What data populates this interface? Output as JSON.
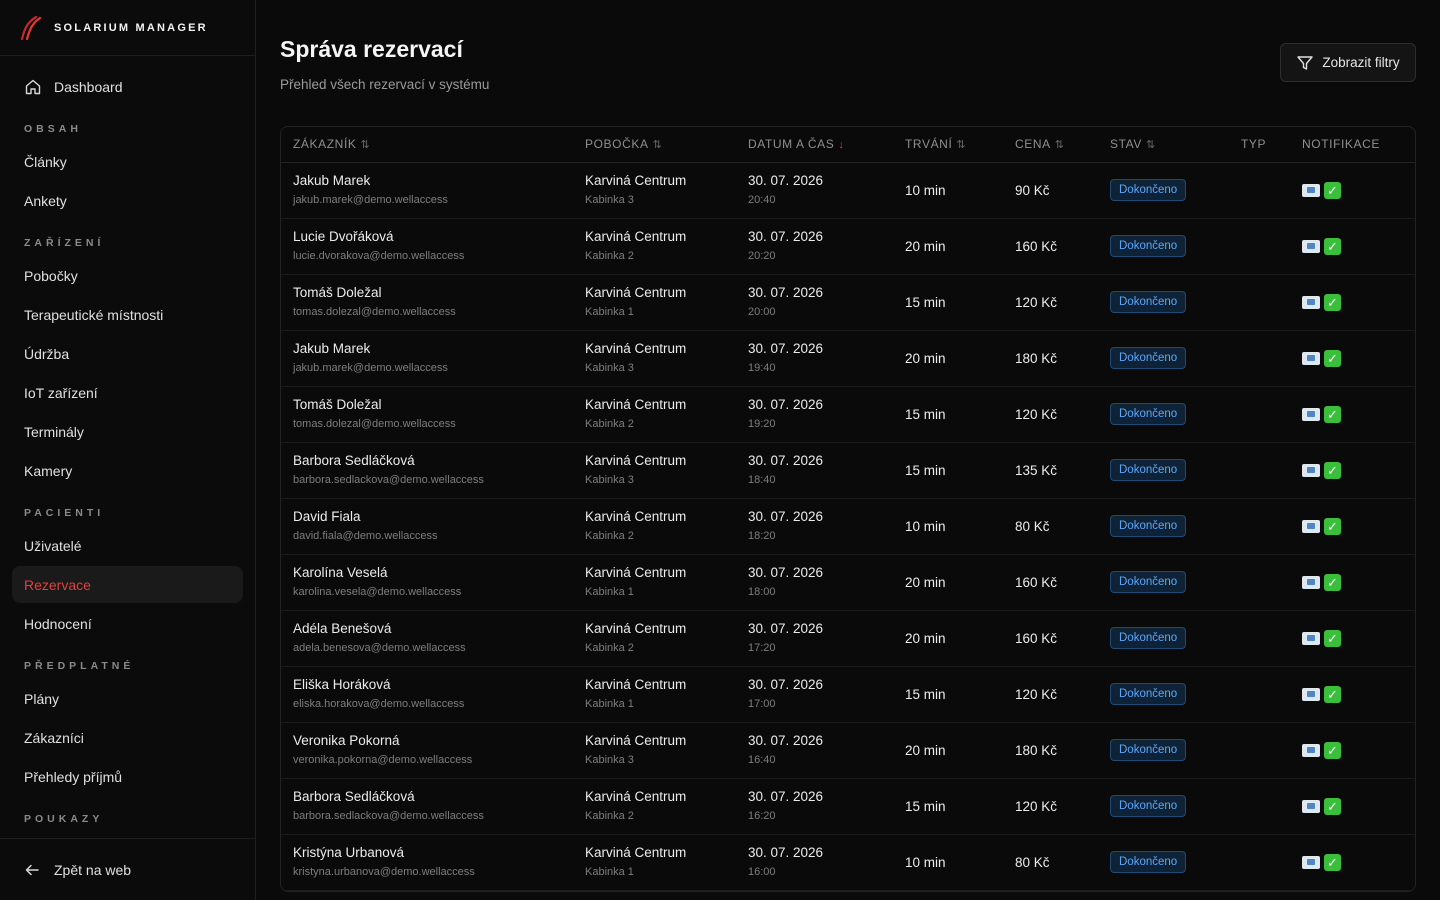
{
  "brand": {
    "name": "SOLARIUM MANAGER"
  },
  "sidebar": {
    "dashboard": "Dashboard",
    "sections": [
      {
        "title": "OBSAH",
        "items": [
          "Články",
          "Ankety"
        ]
      },
      {
        "title": "ZAŘÍZENÍ",
        "items": [
          "Pobočky",
          "Terapeutické místnosti",
          "Údržba",
          "IoT zařízení",
          "Terminály",
          "Kamery"
        ]
      },
      {
        "title": "PACIENTI",
        "items": [
          "Uživatelé",
          "Rezervace",
          "Hodnocení"
        ]
      },
      {
        "title": "PŘEDPLATNÉ",
        "items": [
          "Plány",
          "Zákazníci",
          "Přehledy příjmů"
        ]
      },
      {
        "title": "POUKAZY",
        "items": []
      }
    ],
    "active_item": "Rezervace",
    "footer": "Zpět na web"
  },
  "header": {
    "title": "Správa rezervací",
    "subtitle": "Přehled všech rezervací v systému",
    "filter_button": "Zobrazit filtry"
  },
  "colors": {
    "accent": "#e43f3f",
    "badge_text": "#58a8ff",
    "badge_bg": "#0f2236"
  },
  "table": {
    "columns": [
      {
        "label": "ZÁKAZNÍK",
        "sort": "both"
      },
      {
        "label": "POBOČKA",
        "sort": "both"
      },
      {
        "label": "DATUM A ČAS",
        "sort": "desc"
      },
      {
        "label": "TRVÁNÍ",
        "sort": "both"
      },
      {
        "label": "CENA",
        "sort": "both"
      },
      {
        "label": "STAV",
        "sort": "both"
      },
      {
        "label": "TYP",
        "sort": "none"
      },
      {
        "label": "NOTIFIKACE",
        "sort": "none"
      }
    ],
    "rows": [
      {
        "name": "Jakub Marek",
        "email": "jakub.marek@demo.wellaccess",
        "branch": "Karviná Centrum",
        "cabin": "Kabinka 3",
        "date": "30. 07. 2026",
        "time": "20:40",
        "duration": "10 min",
        "price": "90 Kč",
        "status": "Dokončeno"
      },
      {
        "name": "Lucie Dvořáková",
        "email": "lucie.dvorakova@demo.wellaccess",
        "branch": "Karviná Centrum",
        "cabin": "Kabinka 2",
        "date": "30. 07. 2026",
        "time": "20:20",
        "duration": "20 min",
        "price": "160 Kč",
        "status": "Dokončeno"
      },
      {
        "name": "Tomáš Doležal",
        "email": "tomas.dolezal@demo.wellaccess",
        "branch": "Karviná Centrum",
        "cabin": "Kabinka 1",
        "date": "30. 07. 2026",
        "time": "20:00",
        "duration": "15 min",
        "price": "120 Kč",
        "status": "Dokončeno"
      },
      {
        "name": "Jakub Marek",
        "email": "jakub.marek@demo.wellaccess",
        "branch": "Karviná Centrum",
        "cabin": "Kabinka 3",
        "date": "30. 07. 2026",
        "time": "19:40",
        "duration": "20 min",
        "price": "180 Kč",
        "status": "Dokončeno"
      },
      {
        "name": "Tomáš Doležal",
        "email": "tomas.dolezal@demo.wellaccess",
        "branch": "Karviná Centrum",
        "cabin": "Kabinka 2",
        "date": "30. 07. 2026",
        "time": "19:20",
        "duration": "15 min",
        "price": "120 Kč",
        "status": "Dokončeno"
      },
      {
        "name": "Barbora Sedláčková",
        "email": "barbora.sedlackova@demo.wellaccess",
        "branch": "Karviná Centrum",
        "cabin": "Kabinka 3",
        "date": "30. 07. 2026",
        "time": "18:40",
        "duration": "15 min",
        "price": "135 Kč",
        "status": "Dokončeno"
      },
      {
        "name": "David Fiala",
        "email": "david.fiala@demo.wellaccess",
        "branch": "Karviná Centrum",
        "cabin": "Kabinka 2",
        "date": "30. 07. 2026",
        "time": "18:20",
        "duration": "10 min",
        "price": "80 Kč",
        "status": "Dokončeno"
      },
      {
        "name": "Karolína Veselá",
        "email": "karolina.vesela@demo.wellaccess",
        "branch": "Karviná Centrum",
        "cabin": "Kabinka 1",
        "date": "30. 07. 2026",
        "time": "18:00",
        "duration": "20 min",
        "price": "160 Kč",
        "status": "Dokončeno"
      },
      {
        "name": "Adéla Benešová",
        "email": "adela.benesova@demo.wellaccess",
        "branch": "Karviná Centrum",
        "cabin": "Kabinka 2",
        "date": "30. 07. 2026",
        "time": "17:20",
        "duration": "20 min",
        "price": "160 Kč",
        "status": "Dokončeno"
      },
      {
        "name": "Eliška Horáková",
        "email": "eliska.horakova@demo.wellaccess",
        "branch": "Karviná Centrum",
        "cabin": "Kabinka 1",
        "date": "30. 07. 2026",
        "time": "17:00",
        "duration": "15 min",
        "price": "120 Kč",
        "status": "Dokončeno"
      },
      {
        "name": "Veronika Pokorná",
        "email": "veronika.pokorna@demo.wellaccess",
        "branch": "Karviná Centrum",
        "cabin": "Kabinka 3",
        "date": "30. 07. 2026",
        "time": "16:40",
        "duration": "20 min",
        "price": "180 Kč",
        "status": "Dokončeno"
      },
      {
        "name": "Barbora Sedláčková",
        "email": "barbora.sedlackova@demo.wellaccess",
        "branch": "Karviná Centrum",
        "cabin": "Kabinka 2",
        "date": "30. 07. 2026",
        "time": "16:20",
        "duration": "15 min",
        "price": "120 Kč",
        "status": "Dokončeno"
      },
      {
        "name": "Kristýna Urbanová",
        "email": "kristyna.urbanova@demo.wellaccess",
        "branch": "Karviná Centrum",
        "cabin": "Kabinka 1",
        "date": "30. 07. 2026",
        "time": "16:00",
        "duration": "10 min",
        "price": "80 Kč",
        "status": "Dokončeno"
      }
    ]
  }
}
